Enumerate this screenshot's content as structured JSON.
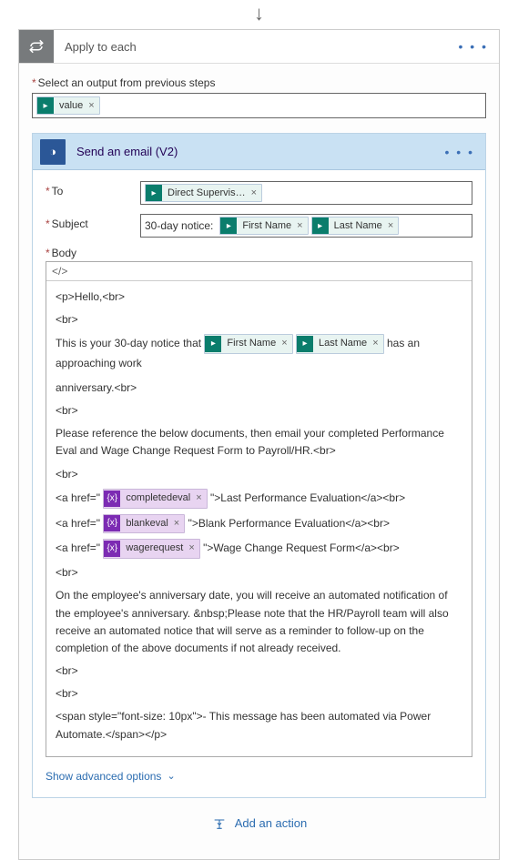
{
  "arrow": "↓",
  "loop": {
    "title": "Apply to each",
    "menu": "• • •",
    "selectLabel": "Select an output from previous steps",
    "token_value": "value"
  },
  "email": {
    "title": "Send an email (V2)",
    "menu": "• • •",
    "toLabel": "To",
    "toToken": "Direct Supervis…",
    "subjectLabel": "Subject",
    "subjectPrefix": "30-day notice:",
    "token_first": "First Name",
    "token_last": "Last Name",
    "bodyLabel": "Body",
    "toolbarGlyph": "</>",
    "body": {
      "l1": "<p>Hello,<br>",
      "l2": "<br>",
      "l3a": "This is your 30-day notice that",
      "l3b": "has an approaching work",
      "l4": "anniversary.<br>",
      "l5": "<br>",
      "l6": "Please reference the below documents, then email your completed Performance Eval and Wage Change Request Form to Payroll/HR.<br>",
      "l7": "<br>",
      "l8a": "<a href=\"",
      "l8b": "\">Last Performance Evaluation</a><br>",
      "tok_completed": "completedeval",
      "l9a": "<a href=\"",
      "l9b": "\">Blank Performance Evaluation</a><br>",
      "tok_blank": "blankeval",
      "l10a": "<a href=\"",
      "l10b": "\">Wage Change Request Form</a><br>",
      "tok_wage": "wagerequest",
      "l11": "<br>",
      "l12": "On the employee's anniversary date, you will receive an automated notification of the employee's anniversary. &nbsp;Please note that the HR/Payroll team will also receive an automated notice that will serve as a reminder to follow-up on the completion of the above documents if not already received.",
      "l13": "<br>",
      "l14": "<br>",
      "l15": "<span style=\"font-size: 10px\">- This message has been automated via Power Automate.</span></p>"
    },
    "advanced": "Show advanced options"
  },
  "addAction": "Add an action"
}
